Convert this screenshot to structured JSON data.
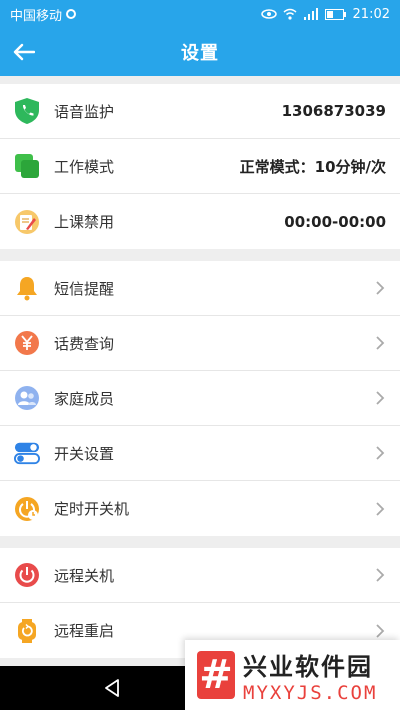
{
  "status_bar": {
    "carrier": "中国移动",
    "time": "21:02"
  },
  "app_bar": {
    "title": "设置"
  },
  "sections": [
    {
      "rows": [
        {
          "label": "语音监护",
          "value": "1306873039",
          "icon": "shield-phone-icon"
        },
        {
          "label": "工作模式",
          "value": "正常模式：10分钟/次",
          "icon": "work-mode-icon"
        },
        {
          "label": "上课禁用",
          "value": "00:00-00:00",
          "icon": "class-disable-icon"
        }
      ]
    },
    {
      "rows": [
        {
          "label": "短信提醒",
          "icon": "bell-icon"
        },
        {
          "label": "话费查询",
          "icon": "yuan-icon"
        },
        {
          "label": "家庭成员",
          "icon": "family-icon"
        },
        {
          "label": "开关设置",
          "icon": "toggle-switches-icon"
        },
        {
          "label": "定时开关机",
          "icon": "timer-power-icon"
        }
      ]
    },
    {
      "rows": [
        {
          "label": "远程关机",
          "icon": "power-icon"
        },
        {
          "label": "远程重启",
          "icon": "restart-icon"
        }
      ]
    }
  ],
  "watermark": {
    "logo": "#",
    "cn": "兴业软件园",
    "url": "MYXYJS.COM"
  },
  "colors": {
    "primary": "#28a5ea",
    "shield": "#2eb85c",
    "work": "#3fbf4a",
    "bell": "#f5a623",
    "yuan": "#f2784b",
    "family": "#5b8fe4",
    "toggle": "#2f83e6",
    "timer": "#f5a623",
    "power": "#e84b4b",
    "restart": "#f5a623"
  }
}
